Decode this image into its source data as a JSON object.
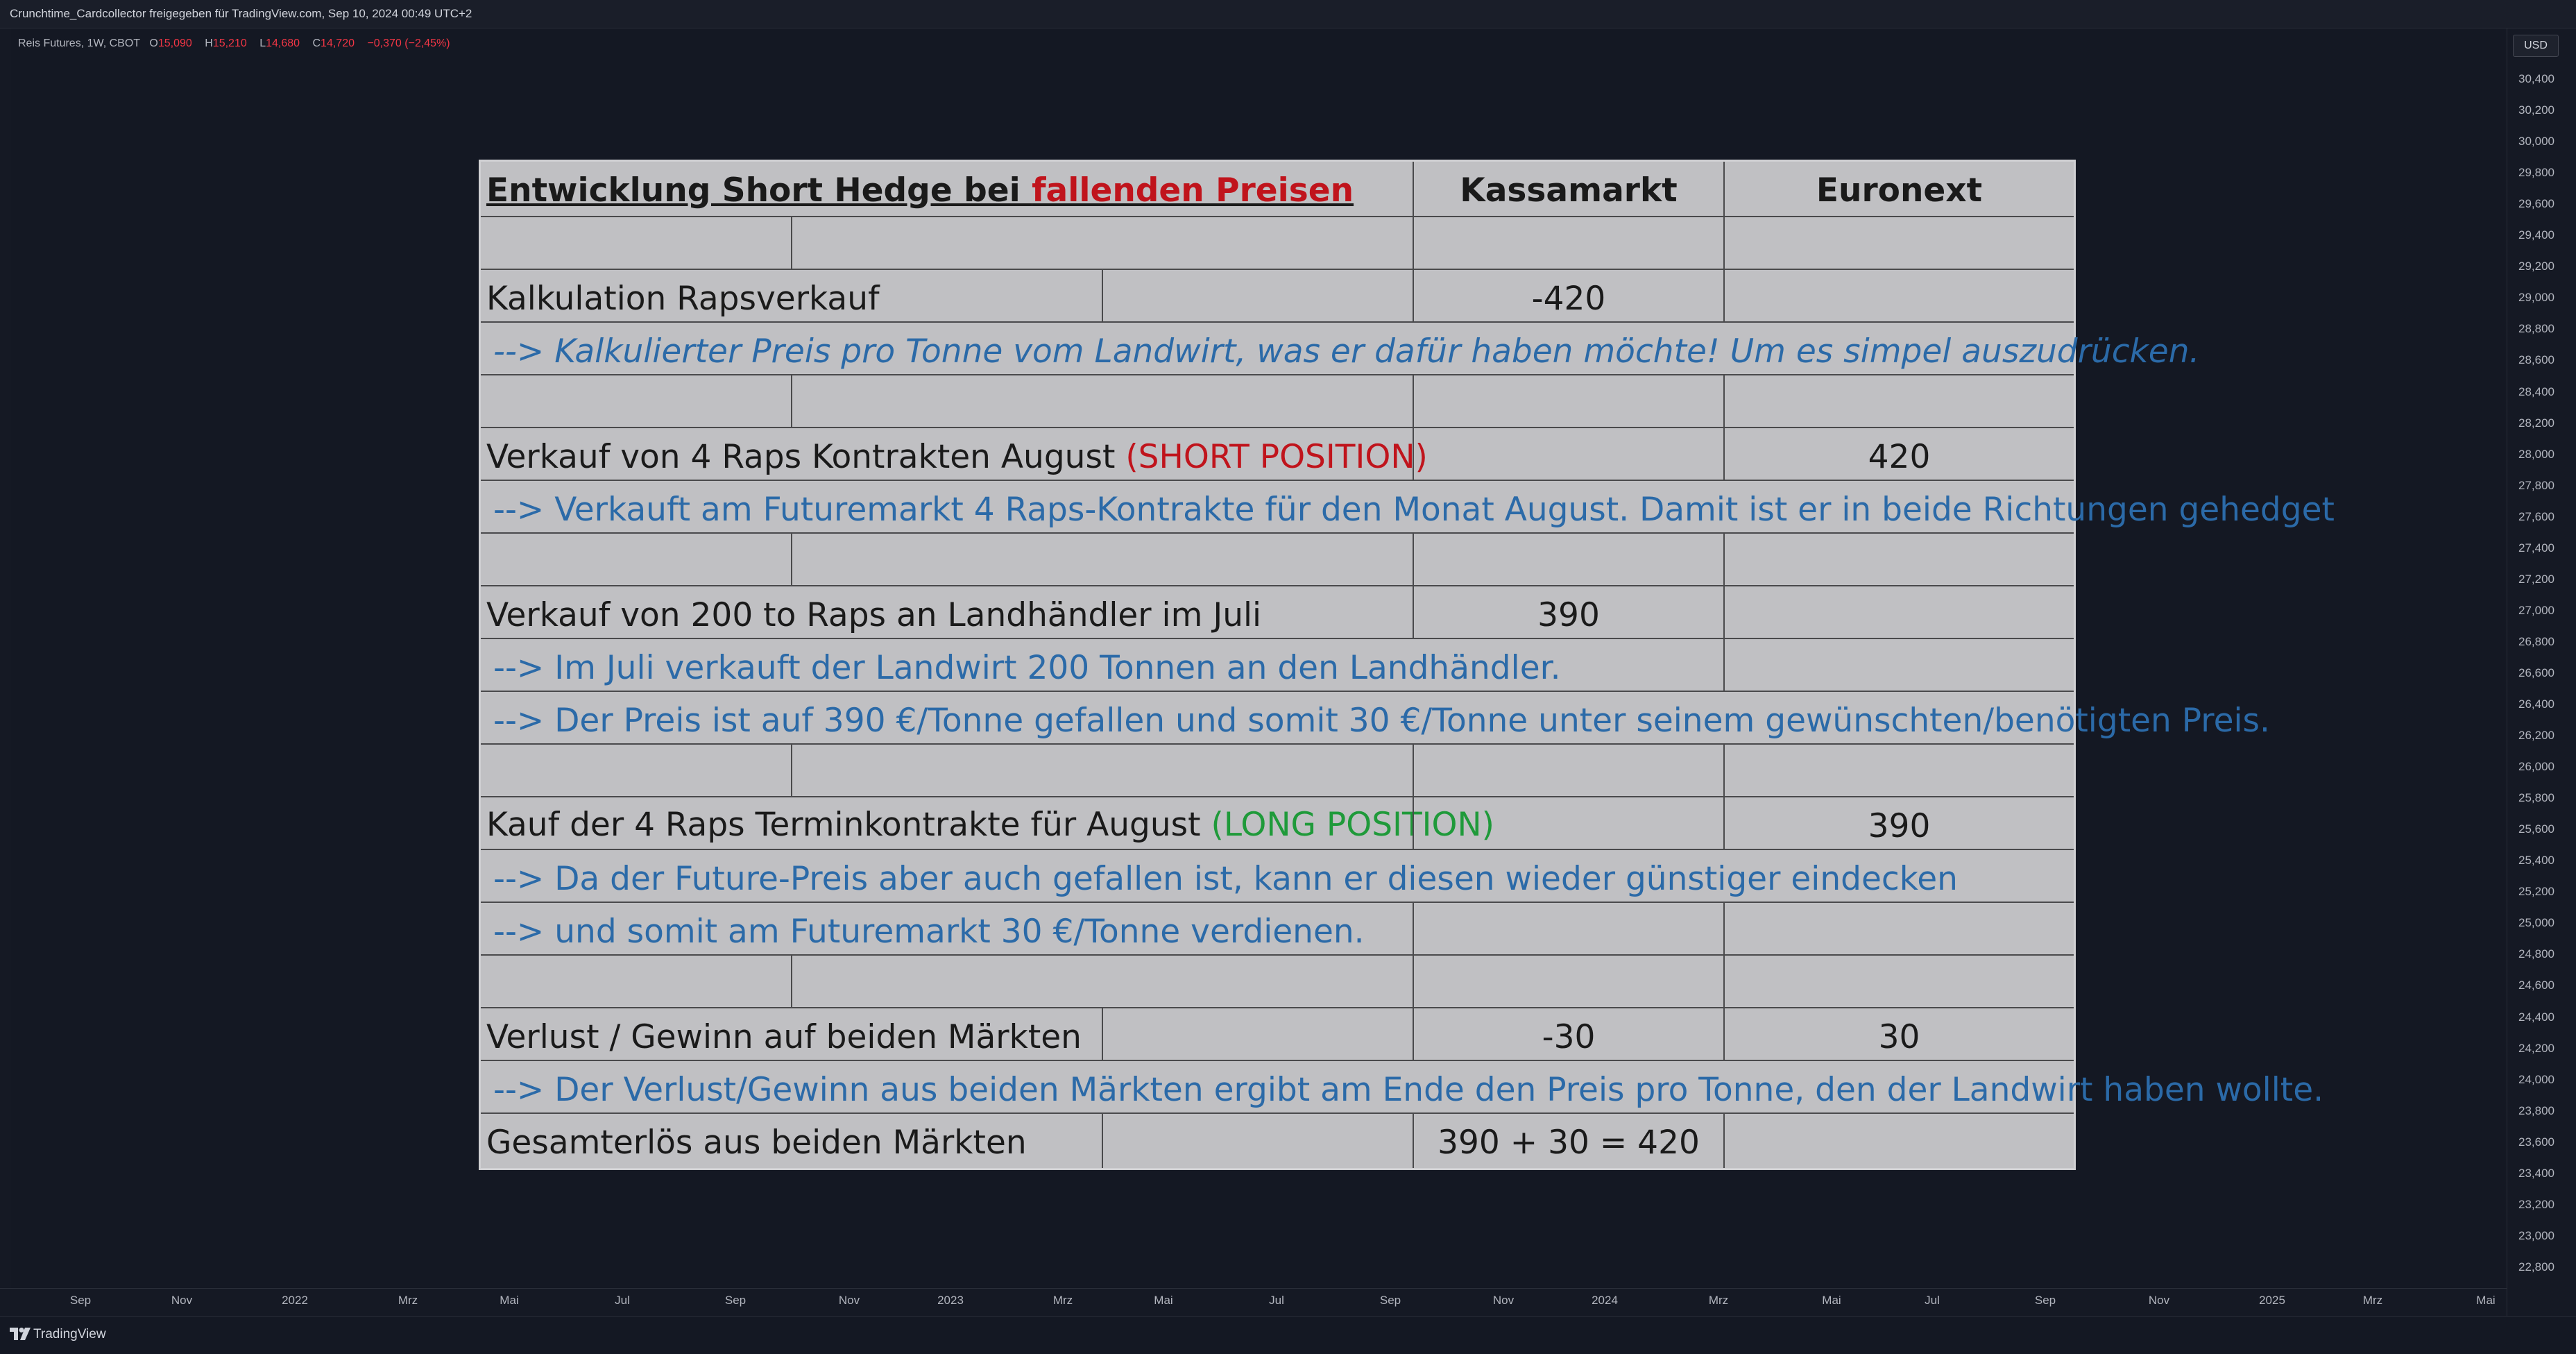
{
  "header": {
    "caption": "Crunchtime_Cardcollector freigegeben für TradingView.com, Sep 10, 2024 00:49 UTC+2"
  },
  "legend": {
    "symbol": "Reis Futures, 1W, CBOT",
    "o_label": "O",
    "o_value": "15,090",
    "h_label": "H",
    "h_value": "15,210",
    "l_label": "L",
    "l_value": "14,680",
    "c_label": "C",
    "c_value": "14,720",
    "change": "−0,370 (−2,45%)"
  },
  "price_axis": {
    "currency": "USD",
    "ticks": [
      "30,400",
      "30,200",
      "30,000",
      "29,800",
      "29,600",
      "29,400",
      "29,200",
      "29,000",
      "28,800",
      "28,600",
      "28,400",
      "28,200",
      "28,000",
      "27,800",
      "27,600",
      "27,400",
      "27,200",
      "27,000",
      "26,800",
      "26,600",
      "26,400",
      "26,200",
      "26,000",
      "25,800",
      "25,600",
      "25,400",
      "25,200",
      "25,000",
      "24,800",
      "24,600",
      "24,400",
      "24,200",
      "24,000",
      "23,800",
      "23,600",
      "23,400",
      "23,200",
      "23,000",
      "22,800"
    ]
  },
  "time_axis": {
    "ticks": [
      "Sep",
      "Nov",
      "2022",
      "Mrz",
      "Mai",
      "Jul",
      "Sep",
      "Nov",
      "2023",
      "Mrz",
      "Mai",
      "Jul",
      "Sep",
      "Nov",
      "2024",
      "Mrz",
      "Mai",
      "Jul",
      "Sep",
      "Nov",
      "2025",
      "Mrz",
      "Mai"
    ]
  },
  "footer": {
    "brand": "TradingView"
  },
  "table": {
    "title_part1": "Entwicklung Short Hedge bei ",
    "title_part2": "fallenden Preisen",
    "col_kassa": "Kassamarkt",
    "col_euronext": "Euronext",
    "r1_label": "Kalkulation Rapsverkauf",
    "r1_kassa": "-420",
    "r1_note": "--> Kalkulierter Preis pro Tonne vom Landwirt, was er dafür haben möchte! Um es simpel auszudrücken.",
    "r2_label": "Verkauf von 4 Raps Kontrakten August ",
    "r2_tag": "(SHORT POSITION)",
    "r2_euronext": "420",
    "r2_note": "--> Verkauft am Futuremarkt 4 Raps-Kontrakte für den Monat August. Damit ist er in beide Richtungen gehedget",
    "r3_label": "Verkauf von 200 to Raps an Landhändler im Juli",
    "r3_kassa": "390",
    "r3_note1": "-->  Im Juli verkauft der Landwirt 200 Tonnen an den Landhändler.",
    "r3_note2": "-->  Der Preis ist auf 390 €/Tonne gefallen und somit 30 €/Tonne unter seinem gewünschten/benötigten Preis.",
    "r4_label": "Kauf der 4 Raps Terminkontrakte für August ",
    "r4_tag": "(LONG POSITION)",
    "r4_euronext": "390",
    "r4_note1": "--> Da der Future-Preis aber auch gefallen ist, kann er diesen wieder günstiger eindecken",
    "r4_note2": "-->  und somit am Futuremarkt 30 €/Tonne verdienen.",
    "r5_label": "Verlust / Gewinn auf beiden Märkten",
    "r5_kassa": "-30",
    "r5_euronext": "30",
    "r5_note": "--> Der Verlust/Gewinn aus beiden Märkten ergibt am Ende den Preis pro Tonne, den der Landwirt haben wollte.",
    "r6_label": "Gesamterlös aus beiden Märkten",
    "r6_kassa": "390 + 30 = 420"
  },
  "colors": {
    "accent_red": "#f23645",
    "background": "#151924"
  }
}
